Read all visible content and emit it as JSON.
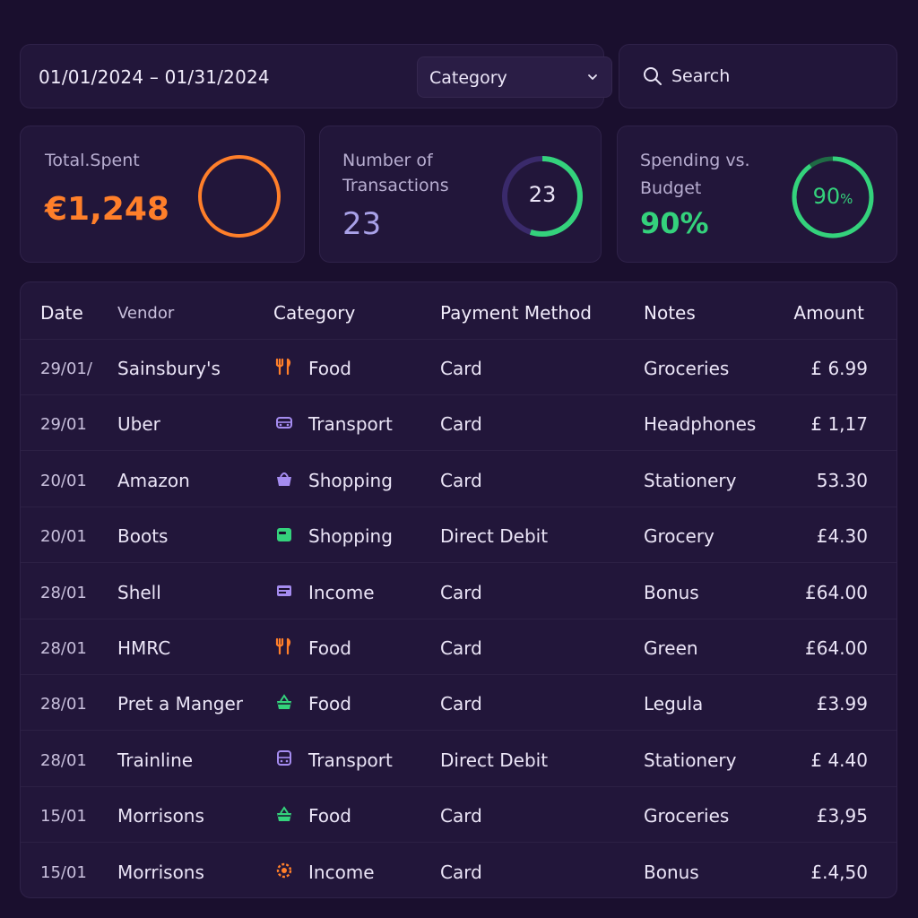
{
  "filters": {
    "date_range": "01/01/2024  – 01/31/2024",
    "category_label": "Category",
    "search_placeholder": "Search"
  },
  "cards": {
    "total_spent": {
      "label": "Total.Spent",
      "value": "€1,248",
      "color": "#ff7f2a"
    },
    "transactions": {
      "label_line1": "Number of",
      "label_line2": "Transactions",
      "value": "23",
      "ring_text": "23",
      "color": "#a9a1e8",
      "ring_fraction": 0.55
    },
    "budget": {
      "label_line1": "Spending vs.",
      "label_line2": "Budget",
      "value": "90%",
      "ring_text": "90",
      "ring_unit": "%",
      "color": "#34d27c",
      "ring_fraction": 0.9
    }
  },
  "table": {
    "headers": {
      "date": "Date",
      "vendor": "Vendor",
      "category": "Category",
      "payment": "Payment Method",
      "notes": "Notes",
      "amount": "Amount"
    },
    "rows": [
      {
        "date": "29/01/",
        "vendor": "Sainsbury's",
        "category": "Food",
        "icon": "fork-knife-icon",
        "icon_color": "#ff7f2a",
        "payment": "Card",
        "notes": "Groceries",
        "amount": "£ 6.99"
      },
      {
        "date": "29/01",
        "vendor": "Uber",
        "category": "Transport",
        "icon": "car-icon",
        "icon_color": "#a58cf0",
        "payment": "Card",
        "notes": "Headphones",
        "amount": "£ 1,17"
      },
      {
        "date": "20/01",
        "vendor": "Amazon",
        "category": "Shopping",
        "icon": "shopping-bag-icon",
        "icon_color": "#a58cf0",
        "payment": "Card",
        "notes": "Stationery",
        "amount": "53.30"
      },
      {
        "date": "20/01",
        "vendor": "Boots",
        "category": "Shopping",
        "icon": "wallet-icon",
        "icon_color": "#34d27c",
        "payment": "Direct Debit",
        "notes": "Grocery",
        "amount": "£4.30"
      },
      {
        "date": "28/01",
        "vendor": "Shell",
        "category": "Income",
        "icon": "card-icon",
        "icon_color": "#a58cf0",
        "payment": "Card",
        "notes": "Bonus",
        "amount": "£64.00"
      },
      {
        "date": "28/01",
        "vendor": "HMRC",
        "category": "Food",
        "icon": "fork-knife-icon",
        "icon_color": "#ff7f2a",
        "payment": "Card",
        "notes": "Green",
        "amount": "£64.00"
      },
      {
        "date": "28/01",
        "vendor": "Pret a Manger",
        "category": "Food",
        "icon": "basket-icon",
        "icon_color": "#34d27c",
        "payment": "Card",
        "notes": "Legula",
        "amount": "£3.99"
      },
      {
        "date": "28/01",
        "vendor": "Trainline",
        "category": "Transport",
        "icon": "bus-icon",
        "icon_color": "#a58cf0",
        "payment": "Direct Debit",
        "notes": "Stationery",
        "amount": "£ 4.40"
      },
      {
        "date": "15/01",
        "vendor": "Morrisons",
        "category": "Food",
        "icon": "basket-icon",
        "icon_color": "#34d27c",
        "payment": "Card",
        "notes": "Groceries",
        "amount": "£3,95"
      },
      {
        "date": "15/01",
        "vendor": "Morrisons",
        "category": "Income",
        "icon": "gear-badge-icon",
        "icon_color": "#ff7f2a",
        "payment": "Card",
        "notes": "Bonus",
        "amount": "£.4,50"
      }
    ]
  }
}
